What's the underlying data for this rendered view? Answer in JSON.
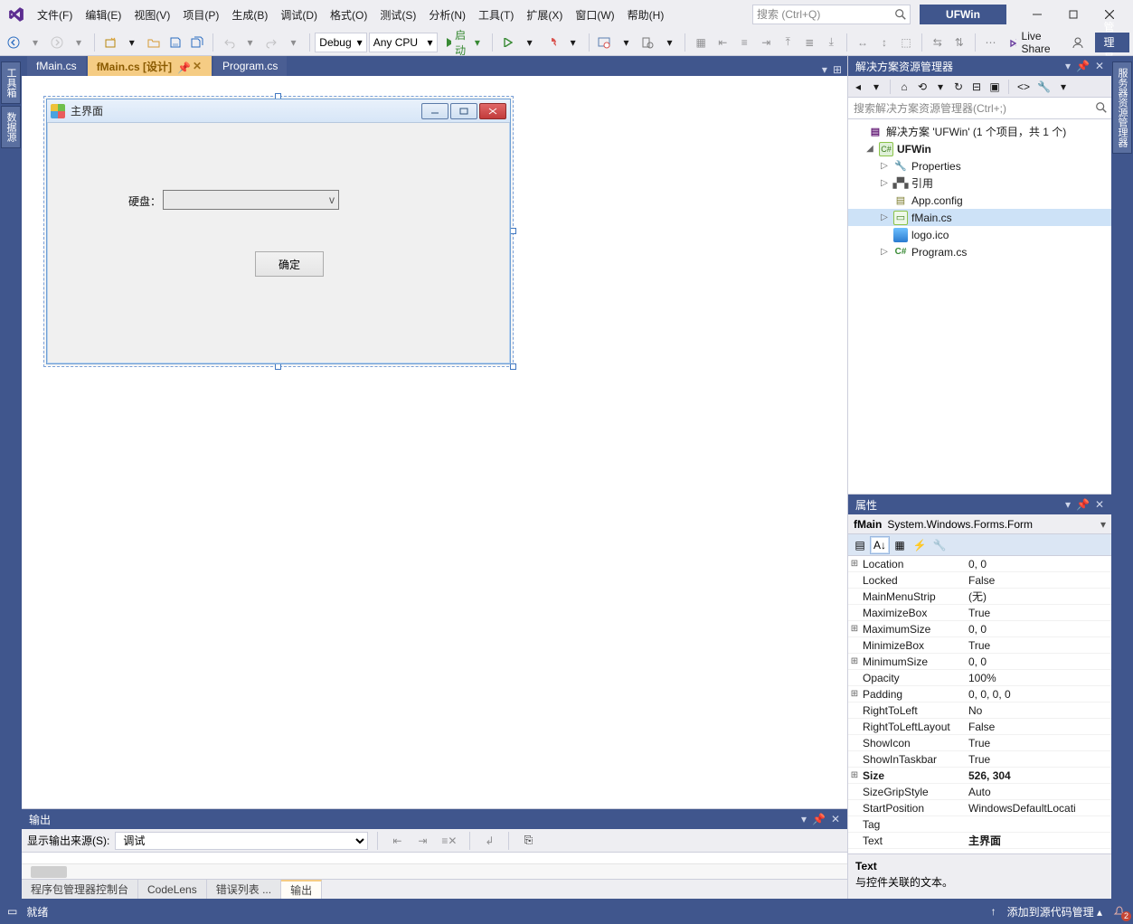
{
  "title_project": "UFWin",
  "menus": [
    "文件(F)",
    "编辑(E)",
    "视图(V)",
    "项目(P)",
    "生成(B)",
    "调试(D)",
    "格式(O)",
    "测试(S)",
    "分析(N)",
    "工具(T)",
    "扩展(X)",
    "窗口(W)",
    "帮助(H)"
  ],
  "search_placeholder": "搜索 (Ctrl+Q)",
  "toolbar": {
    "config": "Debug",
    "platform": "Any CPU",
    "start": "启动",
    "live_share": "Live Share",
    "admin": "管理员"
  },
  "left_rail": [
    "工具箱",
    "数据源"
  ],
  "right_rail_tab": "服务器资源管理器",
  "doc_tabs": [
    {
      "label": "fMain.cs",
      "active": false
    },
    {
      "label": "fMain.cs [设计]",
      "active": true
    },
    {
      "label": "Program.cs",
      "active": false
    }
  ],
  "form": {
    "title": "主界面",
    "disk_label": "硬盘：",
    "ok": "确定"
  },
  "solution_explorer": {
    "title": "解决方案资源管理器",
    "search_placeholder": "搜索解决方案资源管理器(Ctrl+;)",
    "root": "解决方案 'UFWin' (1 个项目，共 1 个)",
    "project": "UFWin",
    "items": [
      "Properties",
      "引用",
      "App.config",
      "fMain.cs",
      "logo.ico",
      "Program.cs"
    ]
  },
  "properties": {
    "title": "属性",
    "object_name": "fMain",
    "object_type": "System.Windows.Forms.Form",
    "rows": [
      {
        "exp": "⊞",
        "k": "Location",
        "v": "0, 0"
      },
      {
        "exp": "",
        "k": "Locked",
        "v": "False"
      },
      {
        "exp": "",
        "k": "MainMenuStrip",
        "v": "(无)"
      },
      {
        "exp": "",
        "k": "MaximizeBox",
        "v": "True"
      },
      {
        "exp": "⊞",
        "k": "MaximumSize",
        "v": "0, 0"
      },
      {
        "exp": "",
        "k": "MinimizeBox",
        "v": "True"
      },
      {
        "exp": "⊞",
        "k": "MinimumSize",
        "v": "0, 0"
      },
      {
        "exp": "",
        "k": "Opacity",
        "v": "100%"
      },
      {
        "exp": "⊞",
        "k": "Padding",
        "v": "0, 0, 0, 0"
      },
      {
        "exp": "",
        "k": "RightToLeft",
        "v": "No"
      },
      {
        "exp": "",
        "k": "RightToLeftLayout",
        "v": "False"
      },
      {
        "exp": "",
        "k": "ShowIcon",
        "v": "True"
      },
      {
        "exp": "",
        "k": "ShowInTaskbar",
        "v": "True"
      },
      {
        "exp": "⊞",
        "k": "Size",
        "v": "526, 304",
        "bold": true
      },
      {
        "exp": "",
        "k": "SizeGripStyle",
        "v": "Auto"
      },
      {
        "exp": "",
        "k": "StartPosition",
        "v": "WindowsDefaultLocati"
      },
      {
        "exp": "",
        "k": "Tag",
        "v": ""
      },
      {
        "exp": "",
        "k": "Text",
        "v": "主界面",
        "boldv": true
      }
    ],
    "help_key": "Text",
    "help_text": "与控件关联的文本。"
  },
  "output": {
    "title": "输出",
    "source_label": "显示输出来源(S):",
    "source_value": "调试",
    "bottom_tabs": [
      "程序包管理器控制台",
      "CodeLens",
      "错误列表 ...",
      "输出"
    ]
  },
  "status": {
    "ready": "就绪",
    "scm": "添加到源代码管理",
    "bell_count": "2"
  }
}
